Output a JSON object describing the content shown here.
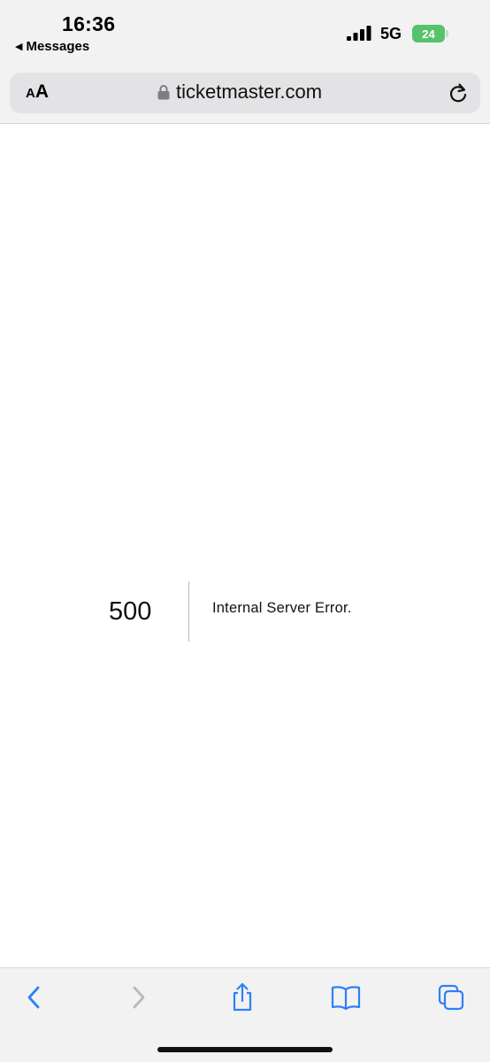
{
  "status_bar": {
    "time": "16:36",
    "back_label": "Messages",
    "network": "5G",
    "battery_level": "24",
    "battery_color": "#58c26a"
  },
  "address_bar": {
    "text_size_small": "A",
    "text_size_large": "A",
    "url": "ticketmaster.com",
    "icons": [
      "text-size-icon",
      "lock-icon",
      "reload-icon"
    ]
  },
  "page": {
    "error_code": "500",
    "error_message": "Internal Server Error."
  },
  "toolbar": {
    "accent": "#2f7ff7",
    "disabled": "#b9b9bd",
    "buttons": [
      "back",
      "forward",
      "share",
      "bookmarks",
      "tabs"
    ],
    "forward_enabled": false
  }
}
